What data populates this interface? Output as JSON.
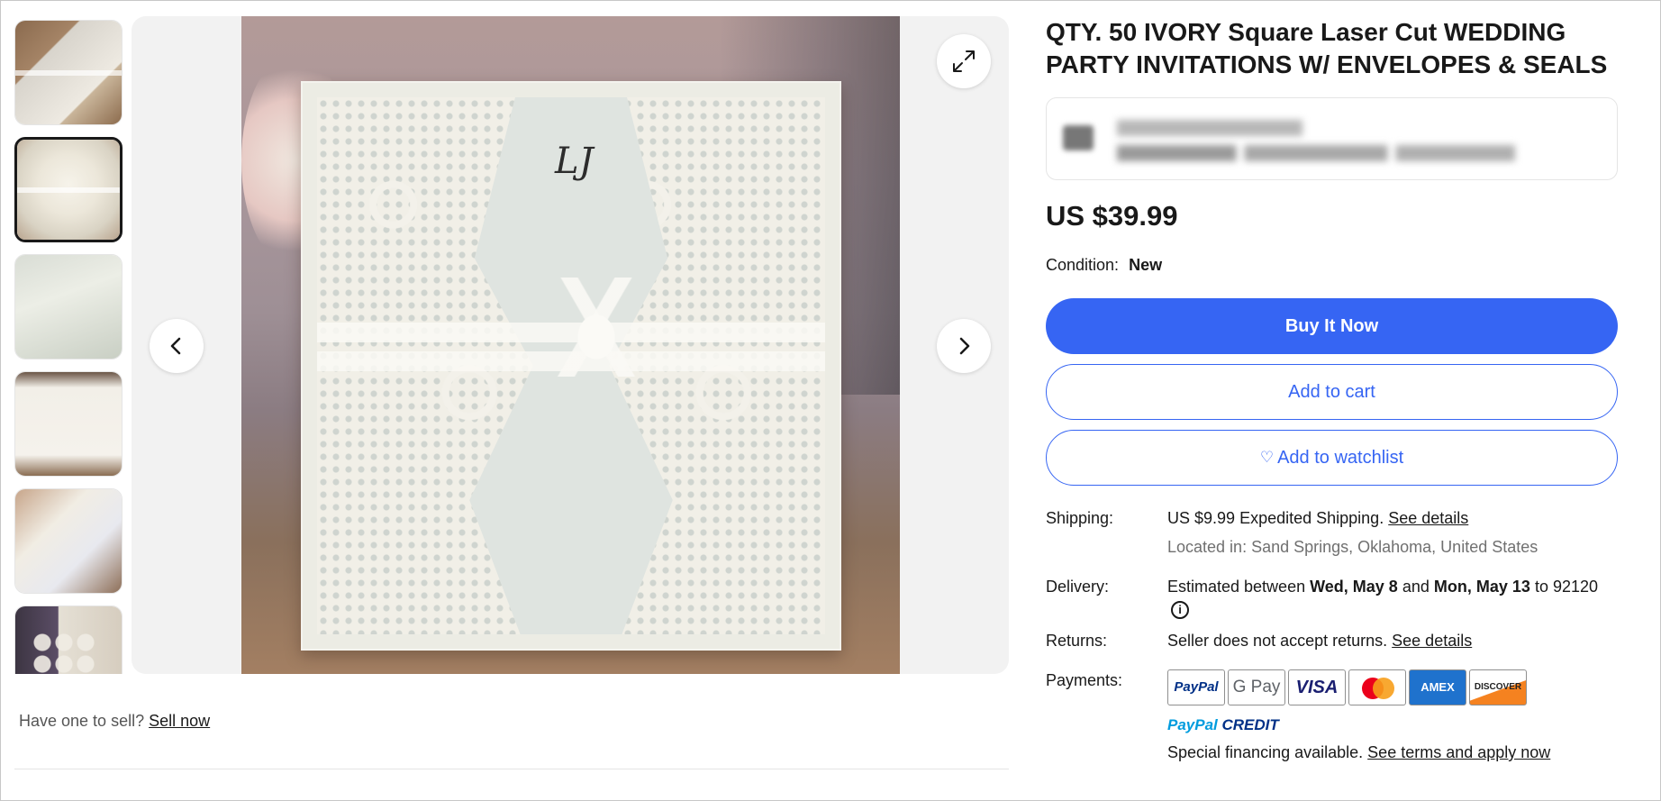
{
  "listing": {
    "title": "QTY. 50 IVORY Square Laser Cut WEDDING PARTY INVITATIONS W/ ENVELOPES & SEALS",
    "price": "US $39.99",
    "condition_label": "Condition:",
    "condition_value": "New"
  },
  "gallery": {
    "monogram": "LJ",
    "thumbnails": [
      "thumbnail-1",
      "thumbnail-2",
      "thumbnail-3",
      "thumbnail-4",
      "thumbnail-5",
      "thumbnail-6"
    ],
    "selected_index": 1
  },
  "actions": {
    "buy_now": "Buy It Now",
    "add_to_cart": "Add to cart",
    "add_to_watchlist": "Add to watchlist"
  },
  "sell": {
    "prompt": "Have one to sell?",
    "link": "Sell now"
  },
  "shipping": {
    "label": "Shipping:",
    "price": "US $9.99",
    "method": "Expedited Shipping.",
    "details_link": "See details",
    "location": "Located in: Sand Springs, Oklahoma, United States"
  },
  "delivery": {
    "label": "Delivery:",
    "prefix": "Estimated between",
    "start": "Wed, May 8",
    "and": "and",
    "end": "Mon, May 13",
    "to": "to 92120"
  },
  "returns": {
    "label": "Returns:",
    "text": "Seller does not accept returns.",
    "details_link": "See details"
  },
  "payments": {
    "label": "Payments:",
    "methods": [
      "PayPal",
      "G Pay",
      "VISA",
      "Mastercard",
      "AMEX",
      "DISCOVER"
    ],
    "amex_label": "AMEX",
    "discover_label": "DISCOVER",
    "paypal_credit_1": "PayPal",
    "paypal_credit_2": "CREDIT",
    "financing_text": "Special financing available.",
    "financing_link": "See terms and apply now"
  },
  "colors": {
    "primary": "#3665f3",
    "text": "#191919",
    "muted": "#707070"
  },
  "icons": {
    "prev": "chevron-left-icon",
    "next": "chevron-right-icon",
    "expand": "expand-icon",
    "heart": "heart-icon",
    "info": "info-icon"
  }
}
